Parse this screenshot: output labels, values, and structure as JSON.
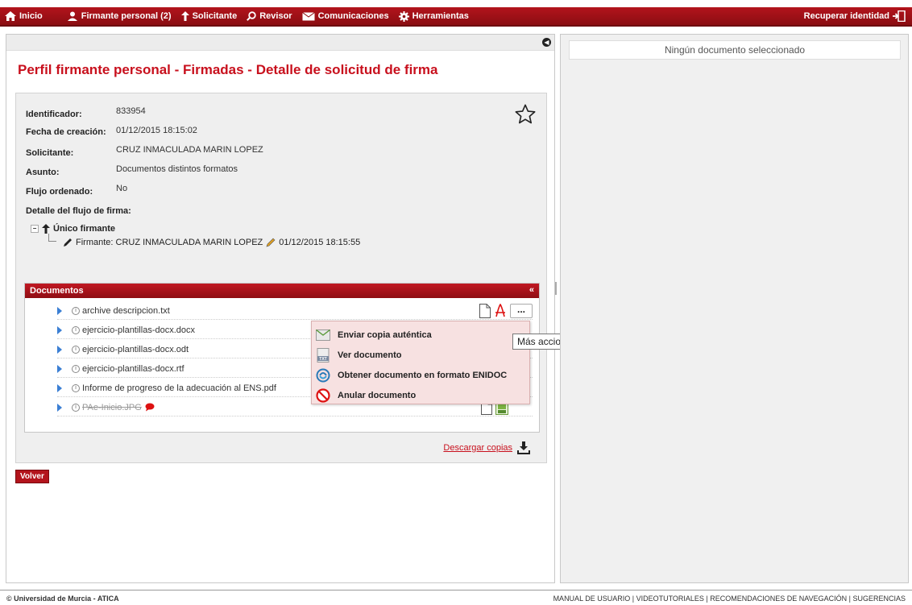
{
  "topbar": {
    "home": "Inicio",
    "personal_signer": "Firmante personal (2)",
    "requester": "Solicitante",
    "reviewer": "Revisor",
    "communications": "Comunicaciones",
    "tools": "Herramientas",
    "recover_identity": "Recuperar identidad"
  },
  "page": {
    "title": "Perfil firmante personal - Firmadas - Detalle de solicitud de firma"
  },
  "details": {
    "identifier_label": "Identificador:",
    "identifier_value": "833954",
    "created_label": "Fecha de creación:",
    "created_value": "01/12/2015 18:15:02",
    "requester_label": "Solicitante:",
    "requester_value": "CRUZ INMACULADA MARIN LOPEZ",
    "subject_label": "Asunto:",
    "subject_value": "Documentos distintos formatos",
    "ordered_label": "Flujo ordenado:",
    "ordered_value": "No",
    "flow_title": "Detalle del flujo de firma:",
    "flow_node": "Único firmante",
    "flow_signer_label": "Firmante: CRUZ INMACULADA MARIN LOPEZ",
    "flow_signer_date": "01/12/2015 18:15:55"
  },
  "documents": {
    "header": "Documentos",
    "items": [
      {
        "name": "archive descripcion.txt"
      },
      {
        "name": "ejercicio-plantillas-docx.docx"
      },
      {
        "name": "ejercicio-plantillas-docx.odt"
      },
      {
        "name": "ejercicio-plantillas-docx.rtf"
      },
      {
        "name": "Informe de progreso de la adecuación al ENS.pdf"
      },
      {
        "name": "PAe-Inicio.JPG"
      }
    ],
    "more_label": "...",
    "download_label": "Descargar copias"
  },
  "context_menu": {
    "items": [
      {
        "label": "Enviar copia auténtica"
      },
      {
        "label": "Ver documento"
      },
      {
        "label": "Obtener documento en formato ENIDOC"
      },
      {
        "label": "Anular documento"
      }
    ]
  },
  "tooltip": "Más acciones",
  "volver": "Volver",
  "right_panel": {
    "no_doc": "Ningún documento seleccionado"
  },
  "footer": {
    "copyright": "© Universidad de Murcia - ATICA",
    "links": "MANUAL DE USUARIO | VIDEOTUTORIALES | RECOMENDACIONES DE NAVEGACIÓN | SUGERENCIAS"
  }
}
